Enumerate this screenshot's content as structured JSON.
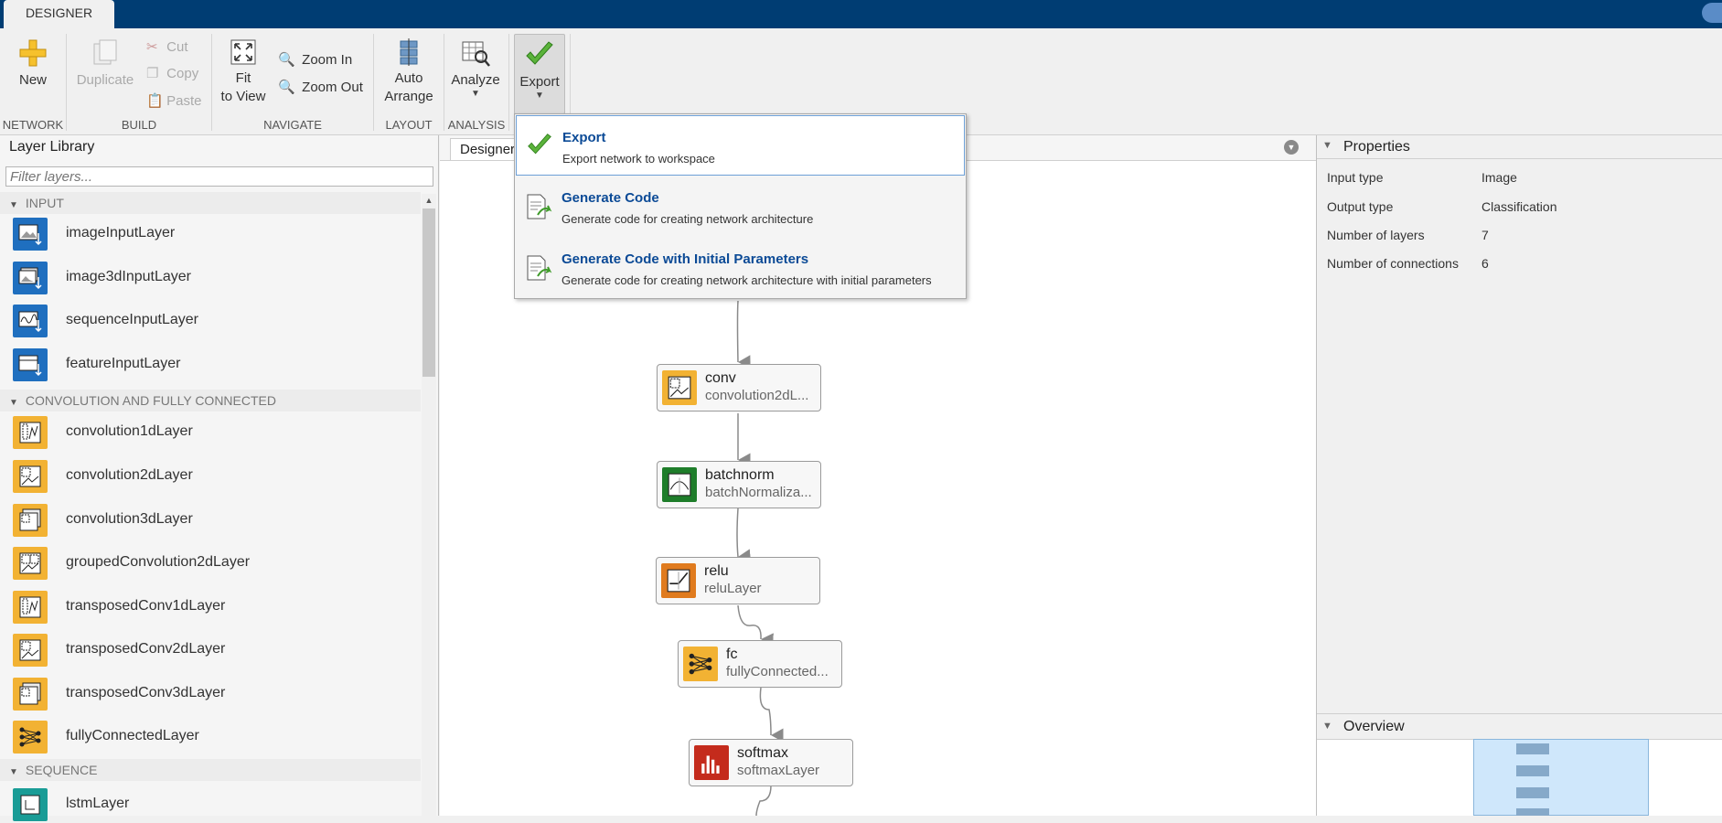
{
  "app": {
    "tab_label": "DESIGNER"
  },
  "ribbon": {
    "new_label": "New",
    "duplicate_label": "Duplicate",
    "cut_label": "Cut",
    "copy_label": "Copy",
    "paste_label": "Paste",
    "fit_label_1": "Fit",
    "fit_label_2": "to View",
    "zoom_in_label": "Zoom In",
    "zoom_out_label": "Zoom Out",
    "auto_label_1": "Auto",
    "auto_label_2": "Arrange",
    "analyze_label": "Analyze",
    "export_label": "Export",
    "sections": {
      "network": "NETWORK",
      "build": "BUILD",
      "navigate": "NAVIGATE",
      "layout": "LAYOUT",
      "analysis": "ANALYSIS"
    }
  },
  "library": {
    "title": "Layer Library",
    "filter_placeholder": "Filter layers...",
    "categories": [
      {
        "name": "INPUT",
        "items": [
          "imageInputLayer",
          "image3dInputLayer",
          "sequenceInputLayer",
          "featureInputLayer"
        ]
      },
      {
        "name": "CONVOLUTION AND FULLY CONNECTED",
        "items": [
          "convolution1dLayer",
          "convolution2dLayer",
          "convolution3dLayer",
          "groupedConvolution2dLayer",
          "transposedConv1dLayer",
          "transposedConv2dLayer",
          "transposedConv3dLayer",
          "fullyConnectedLayer"
        ]
      },
      {
        "name": "SEQUENCE",
        "items": [
          "lstmLayer"
        ]
      }
    ]
  },
  "designer": {
    "tab_label": "Designer",
    "nodes": [
      {
        "name": "conv",
        "type": "convolution2dL..."
      },
      {
        "name": "batchnorm",
        "type": "batchNormaliza..."
      },
      {
        "name": "relu",
        "type": "reluLayer"
      },
      {
        "name": "fc",
        "type": "fullyConnected..."
      },
      {
        "name": "softmax",
        "type": "softmaxLayer"
      }
    ]
  },
  "export_menu": {
    "items": [
      {
        "title": "Export",
        "desc": "Export network to workspace"
      },
      {
        "title": "Generate Code",
        "desc": "Generate code for creating network architecture"
      },
      {
        "title": "Generate Code with Initial Parameters",
        "desc": "Generate code for creating network architecture with initial parameters"
      }
    ]
  },
  "properties": {
    "title": "Properties",
    "rows": [
      {
        "key": "Input type",
        "value": "Image"
      },
      {
        "key": "Output type",
        "value": "Classification"
      },
      {
        "key": "Number of layers",
        "value": "7"
      },
      {
        "key": "Number of connections",
        "value": "6"
      }
    ]
  },
  "overview": {
    "title": "Overview"
  },
  "colors": {
    "title_bar": "#003d73",
    "input_icon": "#1f6fbf",
    "conv_icon": "#f2b233",
    "norm_icon": "#1e7d2a",
    "relu_icon": "#e07b1e",
    "softmax_icon": "#c42b1c",
    "sequence_icon": "#199c96",
    "menu_title": "#0b4a96"
  }
}
